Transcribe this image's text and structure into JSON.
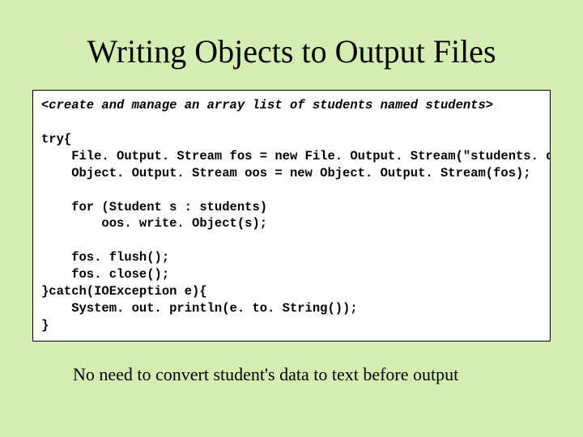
{
  "title": "Writing Objects to Output Files",
  "code": {
    "comment": "<create and manage an array list of students named students>",
    "l1": "try{",
    "l2": "    File. Output. Stream fos = new File. Output. Stream(\"students. dat\");",
    "l3": "    Object. Output. Stream oos = new Object. Output. Stream(fos);",
    "l4": "",
    "l5": "    for (Student s : students)",
    "l6": "        oos. write. Object(s);",
    "l7": "",
    "l8": "    fos. flush();",
    "l9": "    fos. close();",
    "l10": "}catch(IOException e){",
    "l11": "    System. out. println(e. to. String());",
    "l12": "}"
  },
  "footer": "No need to convert student's data to text before output"
}
